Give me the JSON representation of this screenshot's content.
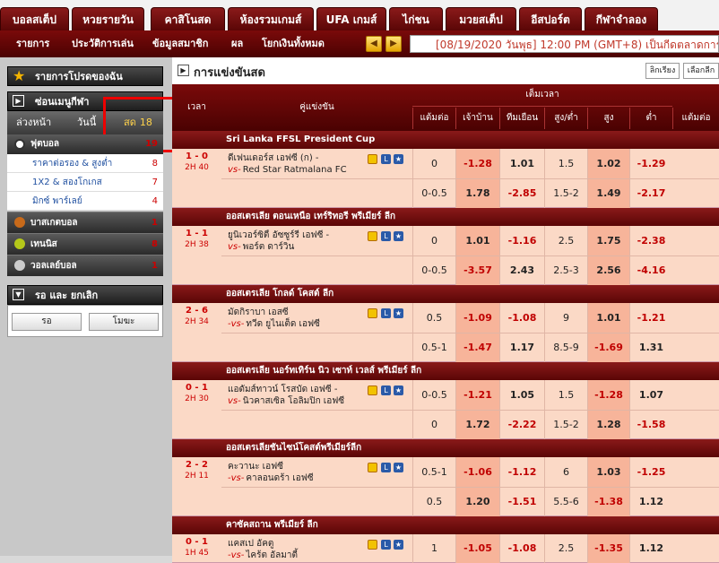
{
  "top_tabs": [
    "บอลสเต็ป",
    "หวยรายวัน",
    "คาสิโนสด",
    "ห้องรวมเกมส์",
    "UFA เกมส์",
    "ไก่ชน",
    "มวยสเต็ป",
    "อีสปอร์ต",
    "กีฬาจำลอง"
  ],
  "sub_nav": [
    "รายการ",
    "ประวัติการเล่น",
    "ข้อมูลสมาชิก",
    "ผล",
    "โยกเงินทั้งหมด"
  ],
  "datetime": "[08/19/2020 วันพุธ] 12:00 PM (GMT+8) เป็นกีดตลาดการรายการ",
  "sidebar": {
    "favorites": "รายการโปรดของฉัน",
    "sports_menu": "ซ่อนเมนูกีฬา",
    "tabs": [
      {
        "label": "ล่วงหน้า"
      },
      {
        "label": "วันนี้"
      },
      {
        "label": "สด",
        "count": "18"
      }
    ],
    "football": {
      "label": "ฟุตบอล",
      "count": "19"
    },
    "sub": [
      {
        "label": "ราคาต่อรอง & สูงต่ำ",
        "count": "8"
      },
      {
        "label": "1X2 & สองโกเกส",
        "count": "7"
      },
      {
        "label": "มิกซ์ พาร์เลย์",
        "count": "4"
      }
    ],
    "other_sports": [
      {
        "label": "บาสเกตบอล",
        "count": "1"
      },
      {
        "label": "เทนนิส",
        "count": "8"
      },
      {
        "label": "วอลเลย์บอล",
        "count": "1"
      }
    ],
    "bet_panel": "รอ และ ยกเลิก",
    "wait_btn": "รอ",
    "cancel_btn": "โมฆะ"
  },
  "main": {
    "title": "การแข่งขันสด",
    "btn_sort": "ลิกเรียง",
    "btn_select": "เลือกลีก",
    "headers": {
      "time": "เวลา",
      "match": "คู่แข่งขัน",
      "fulltime": "เต็มเวลา",
      "hdp": "แต้มต่อ",
      "home": "เจ้าบ้าน",
      "away": "ทีมเยือน",
      "ou": "สูง/ต่ำ",
      "over": "สูง",
      "under": "ต่ำ",
      "hdp2": "แต้มต่อ"
    },
    "leagues": [
      {
        "name": "Sri Lanka FFSL President Cup",
        "matches": [
          {
            "score": "1 - 0",
            "time": "2H 40",
            "home": "ดีเฟนเดอร์ส เอฟซี (ก) -",
            "away": "Red Star Ratmalana FC",
            "vs": "vs-",
            "rows": [
              [
                "0",
                "-1.28",
                "1.01",
                "1.5",
                "1.02",
                "-1.29"
              ],
              [
                "0-0.5",
                "1.78",
                "-2.85",
                "1.5-2",
                "1.49",
                "-2.17"
              ]
            ]
          }
        ]
      },
      {
        "name": "ออสเตรเลีย ตอนเหนือ เทร์ริทอรี พรีเมียร์ ลีก",
        "matches": [
          {
            "score": "1 - 1",
            "time": "2H 38",
            "home": "ยูนิเวอร์ซิตี้ อัซซูร์รี่ เอฟซี -",
            "away": "พอร์ต ดาร์วิน",
            "vs": "vs-",
            "rows": [
              [
                "0",
                "1.01",
                "-1.16",
                "2.5",
                "1.75",
                "-2.38"
              ],
              [
                "0-0.5",
                "-3.57",
                "2.43",
                "2.5-3",
                "2.56",
                "-4.16"
              ]
            ]
          }
        ]
      },
      {
        "name": "ออสเตรเลีย โกลด์ โคสต์ ลีก",
        "matches": [
          {
            "score": "2 - 6",
            "time": "2H 34",
            "home": "มัดกิราบา เอสซี",
            "away": "ทวีด ยูไนเต็ด เอฟซี",
            "vs": "-vs-",
            "rows": [
              [
                "0.5",
                "-1.09",
                "-1.08",
                "9",
                "1.01",
                "-1.21"
              ],
              [
                "0.5-1",
                "-1.47",
                "1.17",
                "8.5-9",
                "-1.69",
                "1.31"
              ]
            ]
          }
        ]
      },
      {
        "name": "ออสเตรเลีย นอร์ทเทิร์น นิว เซาท์ เวลส์ พรีเมียร์ ลีก",
        "matches": [
          {
            "score": "0 - 1",
            "time": "2H 30",
            "home": "แอดัมส์ทาวน์ โรสบัด เอฟซี -",
            "away": "นิวคาสเซิล โอลิมปิก เอฟซี",
            "vs": "vs-",
            "rows": [
              [
                "0-0.5",
                "-1.21",
                "1.05",
                "1.5",
                "-1.28",
                "1.07"
              ],
              [
                "0",
                "1.72",
                "-2.22",
                "1.5-2",
                "1.28",
                "-1.58"
              ]
            ]
          }
        ]
      },
      {
        "name": "ออสเตรเลียชันไซน์โคสต์พรีเมียร์ลีก",
        "matches": [
          {
            "score": "2 - 2",
            "time": "2H 11",
            "home": "คะวานะ เอฟซี",
            "away": "คาลอนดร้า เอฟซี",
            "vs": "-vs-",
            "rows": [
              [
                "0.5-1",
                "-1.06",
                "-1.12",
                "6",
                "1.03",
                "-1.25"
              ],
              [
                "0.5",
                "1.20",
                "-1.51",
                "5.5-6",
                "-1.38",
                "1.12"
              ]
            ]
          }
        ]
      },
      {
        "name": "คาซัคสถาน พรีเมียร์ ลีก",
        "matches": [
          {
            "score": "0 - 1",
            "time": "1H 45",
            "home": "แคสเป อัคตู",
            "away": "ไคร้ต อัลมาตี้",
            "vs": "-vs-",
            "rows": [
              [
                "1",
                "-1.05",
                "-1.08",
                "2.5",
                "-1.35",
                "1.12"
              ]
            ]
          }
        ]
      }
    ]
  }
}
